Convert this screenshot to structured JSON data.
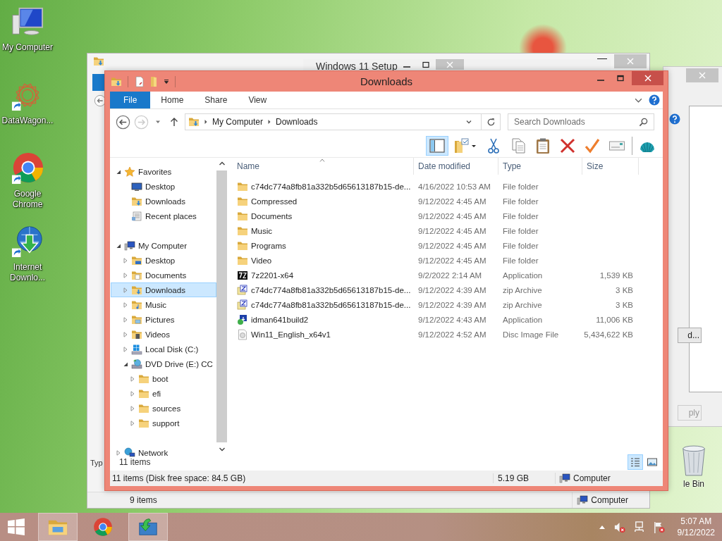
{
  "desktop": {
    "icons": [
      {
        "kind": "computer",
        "label": "My Computer"
      },
      {
        "kind": "star-logo",
        "label": "DataWagon..."
      },
      {
        "kind": "chrome",
        "label": "Google Chrome"
      },
      {
        "kind": "download-manager",
        "label": "Internet Downlo..."
      }
    ],
    "recycle_bin": {
      "label": "le Bin"
    }
  },
  "background_windows": {
    "explorer": {
      "column_header": "Typ",
      "status_items": "9 items",
      "status_location": "Computer"
    },
    "setup": {
      "title": "Windows 11 Setup"
    },
    "dialog": {
      "buttons": [
        {
          "label": "d...",
          "disabled": false
        },
        {
          "label": "ply",
          "disabled": true
        }
      ]
    }
  },
  "window": {
    "title": "Downloads",
    "tabs": [
      {
        "label": "File",
        "selected": true
      },
      {
        "label": "Home",
        "selected": false
      },
      {
        "label": "Share",
        "selected": false
      },
      {
        "label": "View",
        "selected": false
      }
    ],
    "address": {
      "crumbs": [
        "My Computer",
        "Downloads"
      ]
    },
    "search": {
      "placeholder": "Search Downloads"
    },
    "toolbar": [
      {
        "kind": "preview-pane",
        "on": true
      },
      {
        "kind": "folder-options"
      },
      {
        "kind": "cut"
      },
      {
        "kind": "copy"
      },
      {
        "kind": "paste"
      },
      {
        "kind": "delete"
      },
      {
        "kind": "check"
      },
      {
        "kind": "card"
      },
      {
        "kind": "shell"
      }
    ],
    "nav": [
      {
        "label": "Favorites",
        "kind": "star",
        "selected": false,
        "expanded": true,
        "children": [
          {
            "label": "Desktop",
            "kind": "desktop",
            "selected": false
          },
          {
            "label": "Downloads",
            "kind": "downloads",
            "selected": false
          },
          {
            "label": "Recent places",
            "kind": "recent",
            "selected": false
          }
        ]
      },
      {
        "label": "My Computer",
        "kind": "computer",
        "selected": false,
        "expanded": true,
        "children": [
          {
            "label": "Desktop",
            "kind": "desktop-folder",
            "selected": false,
            "expanded": false
          },
          {
            "label": "Documents",
            "kind": "documents",
            "selected": false,
            "expanded": false
          },
          {
            "label": "Downloads",
            "kind": "downloads",
            "selected": true,
            "expanded": false
          },
          {
            "label": "Music",
            "kind": "music",
            "selected": false,
            "expanded": false
          },
          {
            "label": "Pictures",
            "kind": "pictures",
            "selected": false,
            "expanded": false
          },
          {
            "label": "Videos",
            "kind": "videos",
            "selected": false,
            "expanded": false
          },
          {
            "label": "Local Disk (C:)",
            "kind": "disk",
            "selected": false,
            "expanded": false
          },
          {
            "label": "DVD Drive (E:) CC",
            "kind": "dvd",
            "selected": false,
            "expanded": true,
            "children": [
              {
                "label": "boot",
                "kind": "folder",
                "selected": false,
                "expanded": false
              },
              {
                "label": "efi",
                "kind": "folder",
                "selected": false,
                "expanded": false
              },
              {
                "label": "sources",
                "kind": "folder",
                "selected": false,
                "expanded": false
              },
              {
                "label": "support",
                "kind": "folder",
                "selected": false,
                "expanded": false
              }
            ]
          }
        ]
      },
      {
        "label": "Network",
        "kind": "network",
        "selected": false,
        "expanded": false
      }
    ],
    "columns": [
      "Name",
      "Date modified",
      "Type",
      "Size"
    ],
    "rows": [
      {
        "kind": "folder",
        "name": "c74dc774a8fb81a332b5d65613187b15-de...",
        "date": "4/16/2022 10:53 AM",
        "type": "File folder",
        "size": ""
      },
      {
        "kind": "folder",
        "name": "Compressed",
        "date": "9/12/2022 4:45 AM",
        "type": "File folder",
        "size": ""
      },
      {
        "kind": "folder",
        "name": "Documents",
        "date": "9/12/2022 4:45 AM",
        "type": "File folder",
        "size": ""
      },
      {
        "kind": "folder",
        "name": "Music",
        "date": "9/12/2022 4:45 AM",
        "type": "File folder",
        "size": ""
      },
      {
        "kind": "folder",
        "name": "Programs",
        "date": "9/12/2022 4:45 AM",
        "type": "File folder",
        "size": ""
      },
      {
        "kind": "folder",
        "name": "Video",
        "date": "9/12/2022 4:45 AM",
        "type": "File folder",
        "size": ""
      },
      {
        "kind": "sevenzip",
        "name": "7z2201-x64",
        "date": "9/2/2022 2:14 AM",
        "type": "Application",
        "size": "1,539 KB"
      },
      {
        "kind": "zip",
        "name": "c74dc774a8fb81a332b5d65613187b15-de...",
        "date": "9/12/2022 4:39 AM",
        "type": "zip Archive",
        "size": "3 KB"
      },
      {
        "kind": "zip",
        "name": "c74dc774a8fb81a332b5d65613187b15-de...",
        "date": "9/12/2022 4:39 AM",
        "type": "zip Archive",
        "size": "3 KB"
      },
      {
        "kind": "installer",
        "name": "idman641build2",
        "date": "9/12/2022 4:43 AM",
        "type": "Application",
        "size": "11,006 KB"
      },
      {
        "kind": "disc",
        "name": "Win11_English_x64v1",
        "date": "9/12/2022 4:52 AM",
        "type": "Disc Image File",
        "size": "5,434,622 KB"
      }
    ],
    "item_count": "11 items",
    "view_buttons": [
      {
        "kind": "details",
        "selected": true
      },
      {
        "kind": "large-icons",
        "selected": false
      }
    ],
    "status_bar": {
      "summary": "11 items (Disk free space: 84.5 GB)",
      "size": "5.19 GB",
      "location": "Computer"
    }
  },
  "taskbar": {
    "apps": [
      {
        "kind": "explorer",
        "open": true
      },
      {
        "kind": "chrome",
        "open": false
      },
      {
        "kind": "setup",
        "open": true
      }
    ],
    "clock": {
      "time": "5:07 AM",
      "date": "9/12/2022"
    }
  }
}
